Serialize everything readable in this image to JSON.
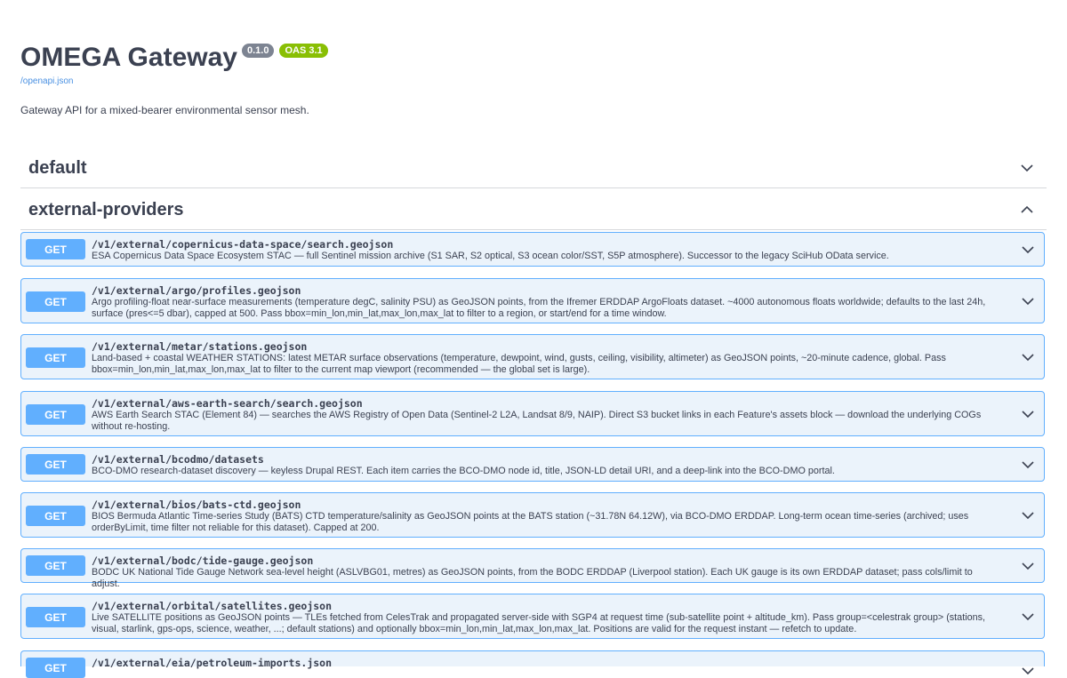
{
  "info": {
    "title": "OMEGA Gateway",
    "version": "0.1.0",
    "oas": "OAS 3.1",
    "spec_link": "/openapi.json",
    "description": "Gateway API for a mixed-bearer environmental sensor mesh."
  },
  "colors": {
    "get": "#61affe",
    "get_bg": "#ebf3fb",
    "version_badge": "#7d8492",
    "oas_badge": "#89bf04",
    "link": "#4990e2"
  },
  "tags": [
    {
      "name": "default",
      "expanded": false,
      "icon": "chevron-down-icon"
    },
    {
      "name": "external-providers",
      "expanded": true,
      "icon": "chevron-up-icon"
    }
  ],
  "operations": [
    {
      "method": "GET",
      "path": "/v1/external/copernicus-data-space/search.geojson",
      "description": "ESA Copernicus Data Space Ecosystem STAC — full Sentinel mission archive (S1 SAR, S2 optical, S3 ocean color/SST, S5P atmosphere). Successor to the legacy SciHub OData service."
    },
    {
      "method": "GET",
      "path": "/v1/external/argo/profiles.geojson",
      "description": "Argo profiling-float near-surface measurements (temperature degC, salinity PSU) as GeoJSON points, from the Ifremer ERDDAP ArgoFloats dataset. ~4000 autonomous floats worldwide; defaults to the last 24h, surface (pres<=5 dbar), capped at 500. Pass bbox=min_lon,min_lat,max_lon,max_lat to filter to a region, or start/end for a time window."
    },
    {
      "method": "GET",
      "path": "/v1/external/metar/stations.geojson",
      "description": "Land-based + coastal WEATHER STATIONS: latest METAR surface observations (temperature, dewpoint, wind, gusts, ceiling, visibility, altimeter) as GeoJSON points, ~20-minute cadence, global. Pass bbox=min_lon,min_lat,max_lon,max_lat to filter to the current map viewport (recommended — the global set is large)."
    },
    {
      "method": "GET",
      "path": "/v1/external/aws-earth-search/search.geojson",
      "description": "AWS Earth Search STAC (Element 84) — searches the AWS Registry of Open Data (Sentinel-2 L2A, Landsat 8/9, NAIP). Direct S3 bucket links in each Feature's assets block — download the underlying COGs without re-hosting."
    },
    {
      "method": "GET",
      "path": "/v1/external/bcodmo/datasets",
      "description": "BCO-DMO research-dataset discovery — keyless Drupal REST. Each item carries the BCO-DMO node id, title, JSON-LD detail URI, and a deep-link into the BCO-DMO portal."
    },
    {
      "method": "GET",
      "path": "/v1/external/bios/bats-ctd.geojson",
      "description": "BIOS Bermuda Atlantic Time-series Study (BATS) CTD temperature/salinity as GeoJSON points at the BATS station (~31.78N 64.12W), via BCO-DMO ERDDAP. Long-term ocean time-series (archived; uses orderByLimit, time filter not reliable for this dataset). Capped at 200."
    },
    {
      "method": "GET",
      "path": "/v1/external/bodc/tide-gauge.geojson",
      "description": "BODC UK National Tide Gauge Network sea-level height (ASLVBG01, metres) as GeoJSON points, from the BODC ERDDAP (Liverpool station). Each UK gauge is its own ERDDAP dataset; pass cols/limit to adjust."
    },
    {
      "method": "GET",
      "path": "/v1/external/orbital/satellites.geojson",
      "description": "Live SATELLITE positions as GeoJSON points — TLEs fetched from CelesTrak and propagated server-side with SGP4 at request time (sub-satellite point + altitude_km). Pass group=<celestrak group> (stations, visual, starlink, gps-ops, science, weather, ...; default stations) and optionally bbox=min_lon,min_lat,max_lon,max_lat. Positions are valid for the request instant — refetch to update."
    },
    {
      "method": "GET",
      "path": "/v1/external/eia/petroleum-imports.json",
      "description": ""
    }
  ]
}
